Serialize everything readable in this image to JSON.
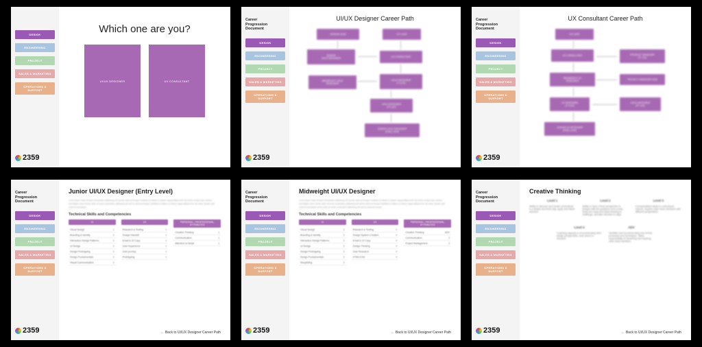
{
  "sidebar": {
    "doc_title": "Career\nProgression\nDocument",
    "items": [
      {
        "label": "DESIGN",
        "class": "nav-design"
      },
      {
        "label": "ENGINEERING",
        "class": "nav-eng"
      },
      {
        "label": "PROJECT",
        "class": "nav-project"
      },
      {
        "label": "SALES & MARKETING",
        "class": "nav-sales"
      },
      {
        "label": "OPERATIONS & SUPPORT",
        "class": "nav-ops"
      }
    ],
    "logo": "2359"
  },
  "slides": {
    "s1": {
      "title": "Which one are you?",
      "tile_a": "UI/UX DESIGNER",
      "tile_b": "UX CONSULTANT"
    },
    "s2": {
      "title": "UI/UX Designer Career Path",
      "nodes": {
        "design_lead": "DESIGN LEAD",
        "ux_lead": "UX LEAD",
        "senior": "SENIOR\nUI/UX DESIGNER",
        "consultant": "UX CONSULTANT",
        "mid": "MIDWEIGHT UI/UX\nDESIGNER",
        "uxd2": "UI/UX DESIGNER\n(1-2 yrs)",
        "uxd1": "UI/UX DESIGNER\n(0-1 yrs)",
        "junior": "JUNIOR UI/UX DESIGNER\n(Entry Level)"
      }
    },
    "s3": {
      "title": "UX Consultant Career Path",
      "nodes": {
        "ux_lead": "UX LEAD",
        "consultant": "UX CONSULTANT",
        "pm": "PRODUCT MANAGER\n(2+ yrs)",
        "mid_ux": "MIDWEIGHT UX\nDESIGNER",
        "pm_side": "PROJECT MANAGER SUB",
        "uxd": "UX DESIGNER\n(1-2 yrs)",
        "uiux": "UI/UX DESIGNER\n(0-1 yrs)",
        "junior": "JUNIOR UX DESIGNER\n(Entry Level)"
      }
    },
    "s4": {
      "title": "Junior UI/UX Designer (Entry Level)",
      "section": "Technical Skills and Competencies",
      "cols": [
        "UI",
        "UX",
        "PERSONAL / PROFESSIONAL ATTRIBUTES"
      ],
      "rows": [
        [
          "Visual Design",
          "Research & Testing",
          "Creative Thinking"
        ],
        [
          "Branding & Identity",
          "Design Handoff",
          "Communication"
        ],
        [
          "Interaction Design Patterns",
          "Email & UI Copy",
          "Attention to Detail"
        ],
        [
          "UI Design",
          "User Experience",
          ""
        ],
        [
          "Design Prototyping",
          "User journey",
          ""
        ],
        [
          "Design Fundamentals",
          "Prototyping",
          ""
        ],
        [
          "Visual Communication",
          "",
          ""
        ]
      ],
      "back": "Back to UI/UX Designer Career Path"
    },
    "s5": {
      "title": "Midweight UI/UX Designer",
      "section": "Technical Skills and Competencies",
      "cols": [
        "UI",
        "UX",
        "PERSONAL / PROFESSIONAL ATTRIBUTES"
      ],
      "rows": [
        [
          "Visual Design",
          "Research & Testing",
          "Creative Thinking"
        ],
        [
          "Branding & Identity",
          "Design System Creation",
          "Communication"
        ],
        [
          "Interaction Design Patterns",
          "Email & UI Copy",
          "Project Management"
        ],
        [
          "UI Design",
          "Design Thinking",
          ""
        ],
        [
          "Design Prototyping",
          "User Research",
          ""
        ],
        [
          "Design Fundamentals",
          "HTML/CSS",
          ""
        ],
        [
          "Storytelling",
          "",
          ""
        ]
      ],
      "back": "Back to UI/UX Designer Career Path"
    },
    "s6": {
      "title": "Creative Thinking",
      "levels": {
        "l1": "Level 1",
        "l2": "Level 2",
        "l3": "Level 3",
        "l4": "Level 4",
        "adv": "ADV"
      },
      "l1_text": "Ability to discover and create connections in a simple and fresh way, apply and follow direction",
      "l2_text": "Ability to have a fresh perspective to designs with the guidance from a lead, bring new ways and ideas thinking to challenge, and take direction to align",
      "l3_text": "Conceptualizes ideas in a structured manner, inspires other team members with different perspectives",
      "l4_text": "Coaching capacity in recommending other design perspectives, lead others to structure",
      "adv_text": "Identifies and recommending new trends, processes and techniques. Takes responsibility of mentoring and inspiring other team members",
      "back": "Back to UI/UX Designer Career Path"
    }
  }
}
